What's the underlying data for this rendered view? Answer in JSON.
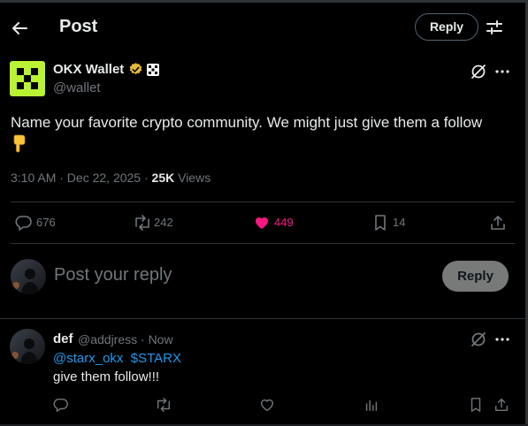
{
  "header": {
    "title": "Post",
    "reply_label": "Reply"
  },
  "post": {
    "author_name": "OKX Wallet",
    "author_handle": "@wallet",
    "text": "Name your favorite crypto community. We might just give them a follow",
    "time": "3:10 AM · Dec 22, 2025 · ",
    "views_count": "25K",
    "views_label": " Views",
    "stats": {
      "replies": "676",
      "reposts": "242",
      "likes": "449",
      "bookmarks": "14"
    },
    "colors": {
      "like_active": "#f91880",
      "avatar_bg": "#b9f334",
      "verified": "#e8b83b"
    }
  },
  "composer": {
    "placeholder": "Post your reply",
    "button_label": "Reply"
  },
  "reply": {
    "name": "def",
    "handle_time": "@addjress · Now",
    "mention": "@starx_okx",
    "cashtag": "$STARX",
    "text": "give them follow!!!"
  }
}
